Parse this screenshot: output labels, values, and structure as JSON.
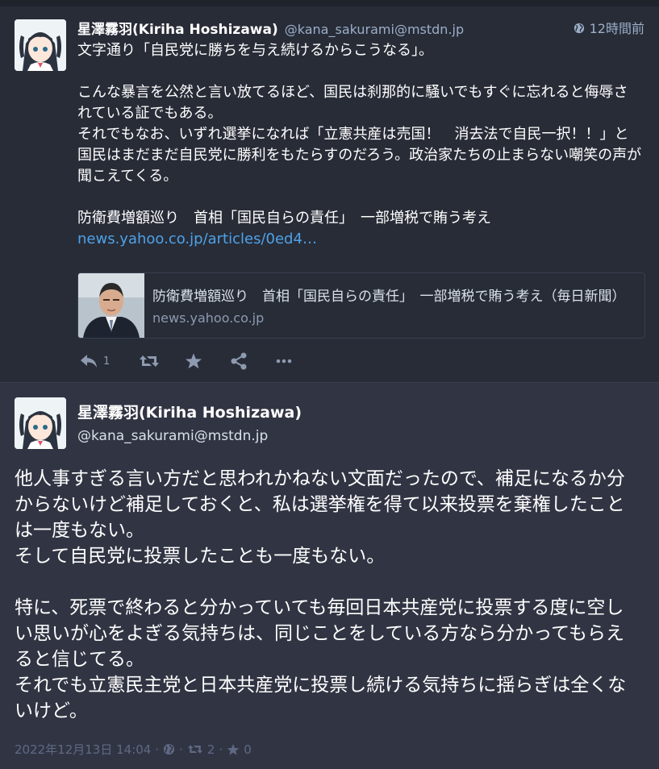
{
  "post1": {
    "display_name": "星澤霧羽(Kiriha Hoshizawa)",
    "acct": "@kana_sakurami@mstdn.jp",
    "time": "12時間前",
    "paragraphs": [
      [
        "文字通り「自民党に勝ちを与え続けるからこうなる」。"
      ],
      [
        "こんな暴言を公然と言い放てるほど、国民は刹那的に騒いでもすぐに忘れると侮辱されている証でもある。",
        "それでもなお、いずれ選挙になれば「立憲共産は売国！　消去法で自民一択！！」と国民はまだまだ自民党に勝利をもたらすのだろう。政治家たちの止まらない嘲笑の声が聞こえてくる。"
      ],
      [
        "防衛費増額巡り　首相「国民自らの責任」　一部増税で賄う考え"
      ]
    ],
    "link_text": "news.yahoo.co.jp/articles/0ed4…",
    "card": {
      "title": "防衛費増額巡り　首相「国民自らの責任」　一部増税で賄う考え（毎日新聞）",
      "domain": "news.yahoo.co.jp"
    },
    "reply_count": "1"
  },
  "post2": {
    "display_name": "星澤霧羽(Kiriha Hoshizawa)",
    "acct": "@kana_sakurami@mstdn.jp",
    "paragraphs": [
      [
        "他人事すぎる言い方だと思われかねない文面だったので、補足になるか分からないけど補足しておくと、私は選挙権を得て以来投票を棄権したことは一度もない。",
        "そして自民党に投票したことも一度もない。"
      ],
      [
        "特に、死票で終わると分かっていても毎回日本共産党に投票する度に空しい思いが心をよぎる気持ちは、同じことをしている方なら分かってもらえると信じてる。",
        "それでも立憲民主党と日本共産党に投票し続ける気持ちに揺らぎは全くないけど。"
      ]
    ],
    "timestamp": "2022年12月13日 14:04",
    "separator": "·",
    "boost_count": "2",
    "fav_count": "0"
  },
  "colors": {
    "background": "#282c37",
    "focused_background": "#313543",
    "link": "#4ea2e8",
    "muted": "#9baec8"
  },
  "icons": [
    "globe-icon",
    "reply-icon",
    "boost-icon",
    "star-icon",
    "share-icon",
    "more-icon"
  ]
}
